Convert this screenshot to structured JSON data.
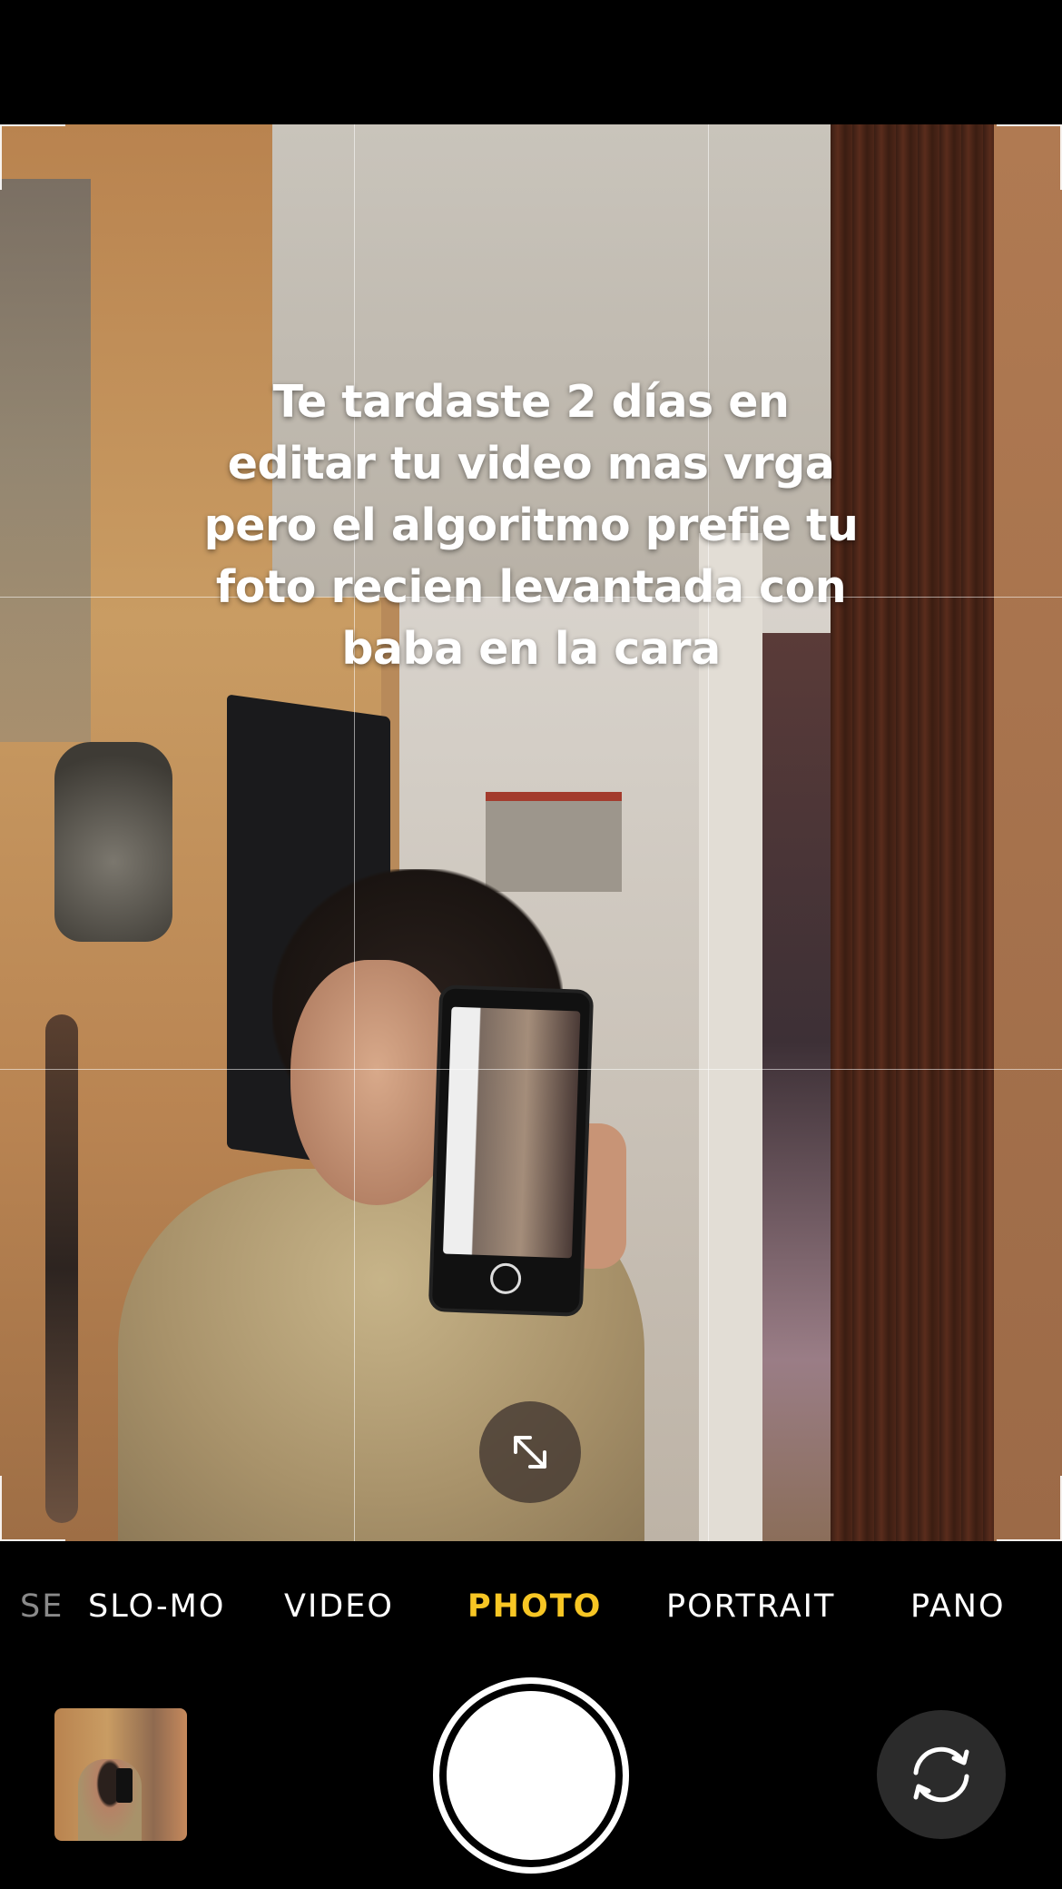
{
  "viewfinder": {
    "caption_lines": [
      "Te tardaste 2 días en",
      "editar tu video mas vrga",
      "pero el algoritmo prefie tu",
      "foto recien levantada con",
      "baba en la cara"
    ],
    "expand_icon": "expand-arrows-icon"
  },
  "modes": {
    "items": [
      {
        "label": "SE",
        "state": "faded"
      },
      {
        "label": "SLO-MO",
        "state": "normal"
      },
      {
        "label": "VIDEO",
        "state": "normal"
      },
      {
        "label": "PHOTO",
        "state": "active"
      },
      {
        "label": "PORTRAIT",
        "state": "normal"
      },
      {
        "label": "PANO",
        "state": "normal"
      }
    ],
    "active_color": "#f7c624"
  },
  "controls": {
    "thumbnail_icon": "last-photo-thumbnail",
    "shutter_icon": "shutter-button",
    "flip_icon": "camera-flip-icon"
  }
}
